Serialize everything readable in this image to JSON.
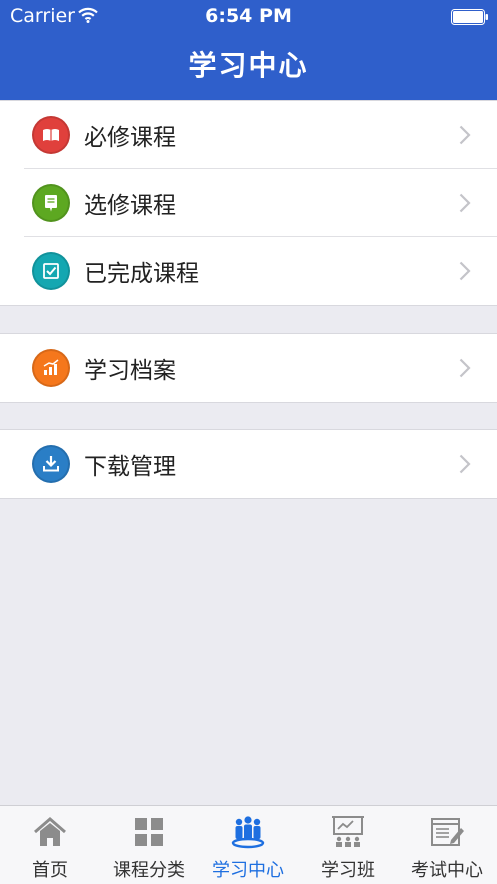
{
  "status_bar": {
    "carrier": "Carrier",
    "time": "6:54 PM"
  },
  "header": {
    "title": "学习中心"
  },
  "groups": [
    {
      "items": [
        {
          "label": "必修课程",
          "icon": "book-icon",
          "color": "#e0403c"
        },
        {
          "label": "选修课程",
          "icon": "document-pen-icon",
          "color": "#5da821"
        },
        {
          "label": "已完成课程",
          "icon": "checkbox-icon",
          "color": "#14a7b1"
        }
      ]
    },
    {
      "items": [
        {
          "label": "学习档案",
          "icon": "growth-chart-icon",
          "color": "#f5771c"
        }
      ]
    },
    {
      "items": [
        {
          "label": "下载管理",
          "icon": "download-icon",
          "color": "#2a7ec6"
        }
      ]
    }
  ],
  "tabbar": {
    "active_color": "#1e6fe0",
    "items": [
      {
        "label": "首页",
        "icon": "home-icon"
      },
      {
        "label": "课程分类",
        "icon": "grid-icon"
      },
      {
        "label": "学习中心",
        "icon": "people-group-icon",
        "active": true
      },
      {
        "label": "学习班",
        "icon": "classroom-icon"
      },
      {
        "label": "考试中心",
        "icon": "exam-icon"
      }
    ]
  }
}
